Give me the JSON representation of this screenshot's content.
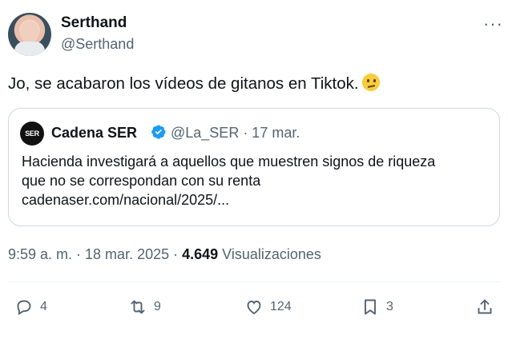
{
  "tweet": {
    "author_name": "Serthand",
    "author_handle": "@Serthand",
    "more_icon": "more-horizontal-icon",
    "text": "Jo, se acabaron los vídeos de gitanos en Tiktok.",
    "emoji": "confused-face-emoji"
  },
  "quote": {
    "logo_text": "SER",
    "name": "Cadena SER",
    "handle_date": "@La_SER · 17 mar.",
    "text_line1": "Hacienda investigará a aquellos que muestren signos de riqueza",
    "text_line2": "que no se correspondan con su renta",
    "text_line3": "cadenaser.com/nacional/2025/..."
  },
  "meta": {
    "time_date": "9:59 a. m. · 18 mar. 2025 · ",
    "views_count": "4.649",
    "views_label": "Visualizaciones"
  },
  "actions": {
    "replies": "4",
    "reposts": "9",
    "likes": "124",
    "bookmarks": "3"
  },
  "colors": {
    "text": "#0f1419",
    "secondary": "#536471",
    "border": "#cfd9de",
    "verified": "#1d9bf0"
  }
}
